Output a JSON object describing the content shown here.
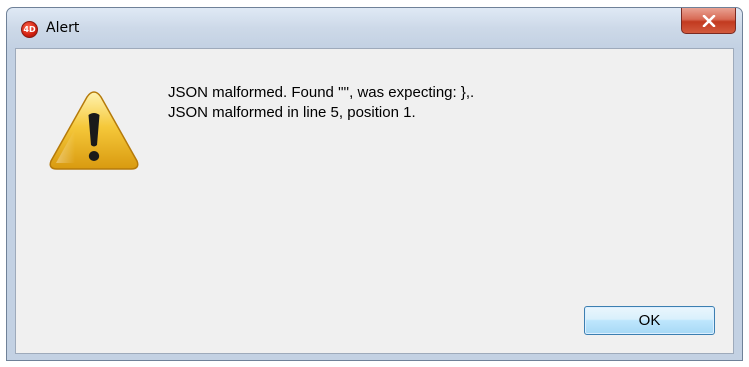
{
  "window": {
    "title": "Alert",
    "app_icon": "4d-app-icon",
    "app_icon_text": "4D"
  },
  "dialog": {
    "icon": "warning-icon",
    "message_line1": "JSON malformed. Found '\"', was expecting: },.",
    "message_line2": "JSON malformed in line 5, position 1.",
    "ok_label": "OK"
  },
  "colors": {
    "close_button": "#c8412a",
    "client_background": "#f0f0f0",
    "ok_border": "#3c7fb1"
  }
}
